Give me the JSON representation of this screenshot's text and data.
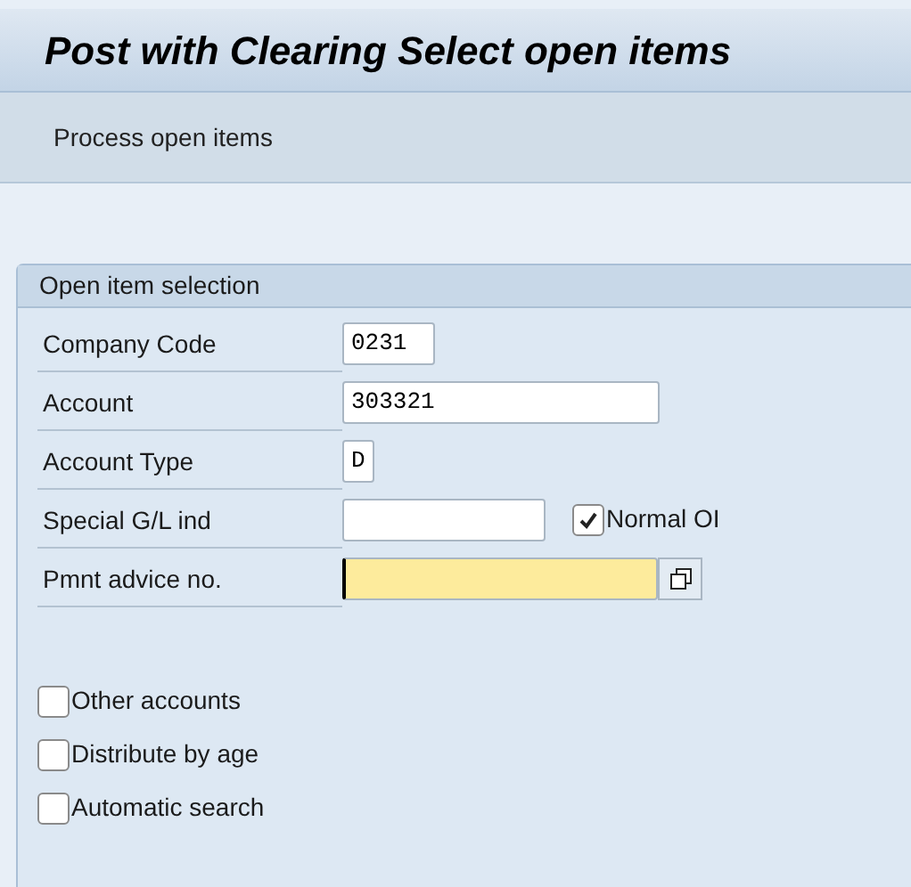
{
  "window": {
    "title": "Post with Clearing Select open items"
  },
  "toolbar": {
    "items": [
      "Process open items"
    ]
  },
  "group": {
    "title": "Open item selection",
    "fields": [
      {
        "label": "Company Code",
        "value": "0231",
        "focused": false
      },
      {
        "label": "Account",
        "value": "303321",
        "focused": false
      },
      {
        "label": "Account Type",
        "value": "D",
        "focused": false
      },
      {
        "label": "Special G/L ind",
        "focused": false,
        "checkbox": {
          "label": "Normal OI",
          "checked": true
        }
      },
      {
        "label": "Pmnt advice no.",
        "focused": true,
        "has_button": true
      }
    ],
    "checkboxes": [
      {
        "label": "Other accounts",
        "checked": false
      },
      {
        "label": "Distribute by age",
        "checked": false
      },
      {
        "label": "Automatic search",
        "checked": false
      }
    ]
  }
}
